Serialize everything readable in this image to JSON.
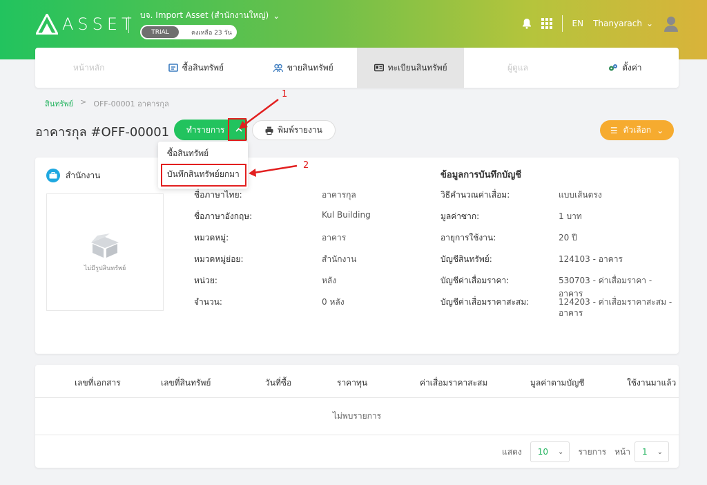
{
  "header": {
    "logo_text": "ASSET",
    "company": "บจ. Import Asset (สำนักงานใหญ่)",
    "trial_label": "TRIAL",
    "trial_remaining": "คงเหลือ 23 วัน",
    "lang": "EN",
    "user": "Thanyarach"
  },
  "nav": {
    "items": [
      {
        "label": "หน้าหลัก"
      },
      {
        "label": "ซื้อสินทรัพย์"
      },
      {
        "label": "ขายสินทรัพย์"
      },
      {
        "label": "ทะเบียนสินทรัพย์"
      },
      {
        "label": "ผู้ดูแล"
      },
      {
        "label": "ตั้งค่า"
      }
    ]
  },
  "breadcrumb": {
    "root": "สินทรัพย์",
    "sep": ">",
    "current": "OFF-00001 อาคารกุล"
  },
  "page": {
    "title": "อาคารกุล #OFF-00001",
    "action_label": "ทำรายการ",
    "print_label": "พิมพ์รายงาน",
    "options_label": "ตัวเลือก"
  },
  "dropdown": {
    "items": [
      "ซื้อสินทรัพย์",
      "บันทึกสินทรัพย์ยกมา"
    ]
  },
  "annotations": {
    "one": "1",
    "two": "2"
  },
  "detail": {
    "branch": "สำนักงาน",
    "no_image": "ไม่มีรูปสินทรัพย์",
    "info": [
      {
        "label": "ชื่อภาษาไทย:",
        "value": "อาคารกุล"
      },
      {
        "label": "ชื่อภาษาอังกฤษ:",
        "value": "Kul Building"
      },
      {
        "label": "หมวดหมู่:",
        "value": "อาคาร"
      },
      {
        "label": "หมวดหมู่ย่อย:",
        "value": "สำนักงาน"
      },
      {
        "label": "หน่วย:",
        "value": "หลัง"
      },
      {
        "label": "จำนวน:",
        "value": "0 หลัง"
      }
    ],
    "accounting_title": "ข้อมูลการบันทึกบัญชี",
    "accounting": [
      {
        "label": "วิธีคำนวณค่าเสื่อม:",
        "value": "แบบเส้นตรง"
      },
      {
        "label": "มูลค่าซาก:",
        "value": "1 บาท"
      },
      {
        "label": "อายุการใช้งาน:",
        "value": "20 ปี"
      },
      {
        "label": "บัญชีสินทรัพย์:",
        "value": "124103 - อาคาร"
      },
      {
        "label": "บัญชีค่าเสื่อมราคา:",
        "value": "530703 - ค่าเสื่อมราคา - อาคาร"
      },
      {
        "label": "บัญชีค่าเสื่อมราคาสะสม:",
        "value": "124203 - ค่าเสื่อมราคาสะสม -",
        "value2": "อาคาร"
      }
    ]
  },
  "table": {
    "columns": [
      "เลขที่เอกสาร",
      "เลขที่สินทรัพย์",
      "วันที่ซื้อ",
      "ราคาทุน",
      "ค่าเสื่อมราคาสะสม",
      "มูลค่าตามบัญชี",
      "ใช้งานมาแล้ว"
    ],
    "empty_text": "ไม่พบรายการ",
    "show_label": "แสดง",
    "page_size": "10",
    "rows_label": "รายการ",
    "page_label": "หน้า",
    "page": "1"
  },
  "colors": {
    "brand_green": "#22c35e",
    "accent_orange": "#f6ab2f",
    "annotation_red": "#e21f1f"
  }
}
